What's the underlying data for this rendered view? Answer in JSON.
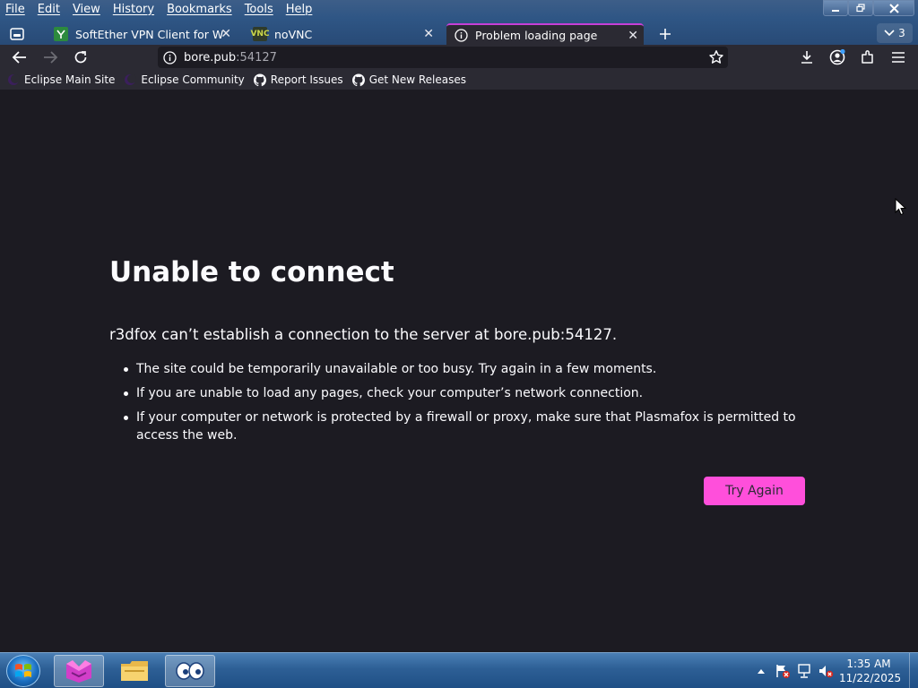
{
  "menubar": {
    "items": [
      "File",
      "Edit",
      "View",
      "History",
      "Bookmarks",
      "Tools",
      "Help"
    ]
  },
  "tabs": [
    {
      "title": "SoftEther VPN Client for Windo",
      "favicon": "softether-icon",
      "active": false
    },
    {
      "title": "noVNC",
      "favicon": "novnc-icon",
      "favicon_text": "VNC",
      "active": false
    },
    {
      "title": "Problem loading page",
      "favicon": "info-icon",
      "active": true
    }
  ],
  "tab_count": "3",
  "url": {
    "host": "bore.pub",
    "port": ":54127"
  },
  "bookmarks": [
    {
      "label": "Eclipse Main Site",
      "icon": "eclipse-icon"
    },
    {
      "label": "Eclipse Community",
      "icon": "eclipse-icon"
    },
    {
      "label": "Report Issues",
      "icon": "github-icon"
    },
    {
      "label": "Get New Releases",
      "icon": "github-icon"
    }
  ],
  "error": {
    "title": "Unable to connect",
    "description": "r3dfox can’t establish a connection to the server at bore.pub:54127.",
    "items": [
      "The site could be temporarily unavailable or too busy. Try again in a few moments.",
      "If you are unable to load any pages, check your computer’s network connection.",
      "If your computer or network is protected by a firewall or proxy, make sure that Plasmafox is permitted to access the web."
    ],
    "button_label": "Try Again"
  },
  "taskbar": {
    "clock_time": "1:35 AM",
    "clock_date": "11/22/2025"
  },
  "colors": {
    "accent": "#ff4fdb",
    "tab_highlight": "#c63fd7",
    "page_bg": "#1c1b22",
    "toolbar_bg": "#2b2a33"
  }
}
